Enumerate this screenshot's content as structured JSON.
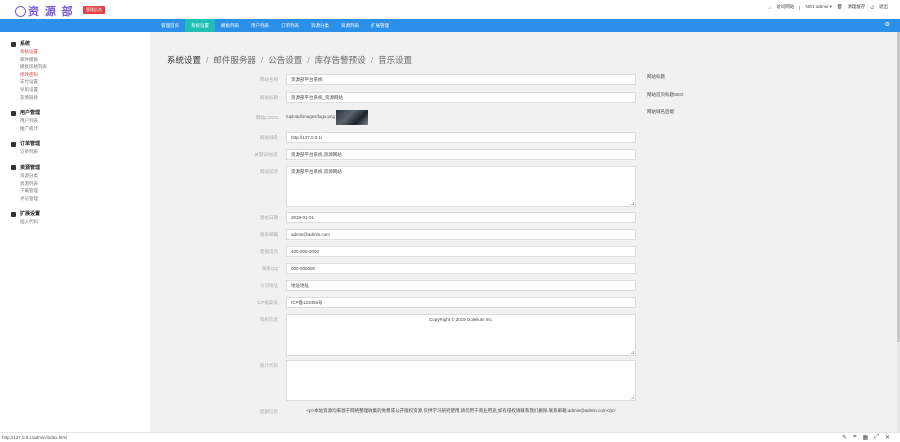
{
  "header": {
    "logo_text": "资 源 部",
    "badge": "管理后台",
    "user_links": [
      "访问网站",
      "NO1 admin ▾",
      "清理缓存",
      "退出"
    ]
  },
  "navbar": {
    "items": [
      {
        "label": "管理首页",
        "active": false
      },
      {
        "label": "系统设置",
        "active": true
      },
      {
        "label": "模板列表",
        "active": false
      },
      {
        "label": "用户列表",
        "active": false
      },
      {
        "label": "订单列表",
        "active": false
      },
      {
        "label": "资源分类",
        "active": false
      },
      {
        "label": "资源列表",
        "active": false
      },
      {
        "label": "扩展管理",
        "active": false
      }
    ],
    "right_icon": "settings-icon"
  },
  "sidebar": {
    "groups": [
      {
        "title": "系统",
        "icon": "gear-icon",
        "items": [
          {
            "label": "系统设置",
            "active": true
          },
          {
            "label": "邮件模板",
            "active": false
          },
          {
            "label": "模板风格列表",
            "active": false
          },
          {
            "label": "修改密码",
            "active": true
          },
          {
            "label": "支付设置",
            "active": false
          },
          {
            "label": "导航设置",
            "active": false
          },
          {
            "label": "友情链接",
            "active": false
          }
        ]
      },
      {
        "title": "用户管理",
        "icon": "user-icon",
        "items": [
          {
            "label": "用户列表",
            "active": false
          },
          {
            "label": "推广统计",
            "active": false
          }
        ]
      },
      {
        "title": "订单管理",
        "icon": "order-icon",
        "items": [
          {
            "label": "订单列表",
            "active": false
          }
        ]
      },
      {
        "title": "资源管理",
        "icon": "resource-icon",
        "items": [
          {
            "label": "资源分类",
            "active": false
          },
          {
            "label": "资源列表",
            "active": false
          },
          {
            "label": "下载管理",
            "active": false
          },
          {
            "label": "评论管理",
            "active": false
          }
        ]
      },
      {
        "title": "扩展设置",
        "icon": "extension-icon",
        "items": [
          {
            "label": "插入代码",
            "active": false
          }
        ]
      }
    ]
  },
  "breadcrumb": {
    "items": [
      "系统设置",
      "邮件服务器",
      "公告设置",
      "库存告警预设",
      "音乐设置"
    ],
    "separator": "/"
  },
  "form": {
    "fields": [
      {
        "label": "网站名称",
        "value": "资源部平台系统",
        "type": "input"
      },
      {
        "label": "网站标题",
        "value": "资源部平台系统_资源网站",
        "type": "input"
      },
      {
        "label": "网站LOGO",
        "value": "/upload/images/logo.png",
        "type": "image"
      },
      {
        "label": "网站域名",
        "value": "http://127.0.0.1/",
        "type": "input"
      },
      {
        "label": "关键词/标签",
        "value": "资源部平台系统,资源网站",
        "type": "input"
      },
      {
        "label": "网站描述",
        "value": "资源部平台系统,资源网站",
        "type": "textarea"
      },
      {
        "label": "建站日期",
        "value": "2019-01-01",
        "type": "input"
      },
      {
        "label": "联系邮箱",
        "value": "admin@admin.com",
        "type": "input"
      },
      {
        "label": "客服电话",
        "value": "400-000-0000",
        "type": "input"
      },
      {
        "label": "联系QQ",
        "value": "000-000000",
        "type": "input"
      },
      {
        "label": "公司地址",
        "value": "地址地址",
        "type": "input"
      },
      {
        "label": "ICP备案号",
        "value": "ICP备123456号",
        "type": "input"
      },
      {
        "label": "版权信息",
        "value": "CopyRight © 2019 Dolelium Inc.",
        "type": "textarea"
      },
      {
        "label": "统计代码",
        "value": "",
        "type": "textarea"
      },
      {
        "label": "底部信息",
        "value": "<p>本站资源均来源于网络整理收集的免费或公开版权资源,仅供学习研究使用,请勿用于商业用途,如有侵权请联系我们删除,联系邮箱:admin@admin.com</p>",
        "type": "textarea"
      }
    ],
    "hints": [
      "网站标题",
      "网站首页标题SEO",
      "网站域名后缀"
    ]
  },
  "statusbar": {
    "url": "http://127.0.0.1/admin/index.html",
    "tools": [
      "pen-icon",
      "crop-icon",
      "grid-icon",
      "fullscreen-icon",
      "close-icon"
    ]
  }
}
